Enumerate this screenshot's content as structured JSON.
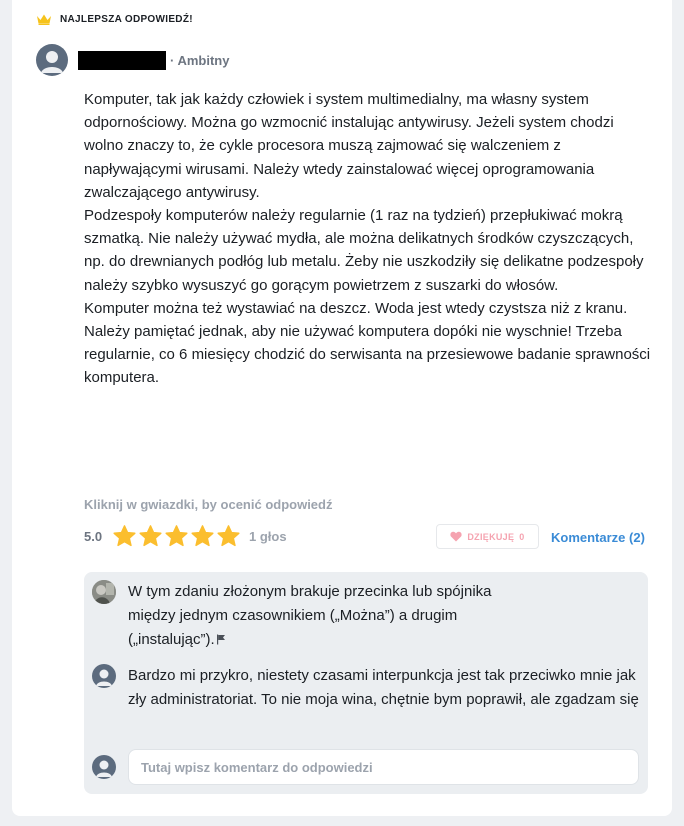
{
  "badge": {
    "label": "NAJLEPSZA ODPOWIEDŹ!",
    "icon": "crown-icon",
    "color": "#f6c31c"
  },
  "author": {
    "rank": "· Ambitny"
  },
  "answer": {
    "paragraphs": [
      "Komputer, tak jak każdy człowiek i system multimedialny, ma własny system odpornościowy. Można go wzmocnić instalując antywirusy. Jeżeli system chodzi wolno znaczy to, że cykle procesora muszą zajmować się walczeniem z napływającymi wirusami. Należy wtedy zainstalować więcej oprogramowania zwalczającego antywirusy.",
      "Podzespoły komputerów należy regularnie (1 raz na tydzień) przepłukiwać mokrą szmatką. Nie należy używać mydła, ale można delikatnych środków czyszczących, np. do drewnianych podłóg lub metalu. Żeby nie uszkodziły się delikatne podzespoły należy szybko wysuszyć go gorącym powietrzem z suszarki do włosów.",
      "Komputer można też wystawiać na deszcz. Woda jest wtedy czystsza niż z kranu. Należy pamiętać jednak, aby nie używać komputera dopóki nie wyschnie! Trzeba regularnie, co 6 miesięcy chodzić do serwisanta na przesiewowe badanie sprawności komputera."
    ]
  },
  "rating": {
    "hint": "Kliknij w gwiazdki, by ocenić odpowiedź",
    "score": "5.0",
    "stars_filled": 5,
    "stars_total": 5,
    "votes": "1 głos",
    "star_color": "#fbbe2e"
  },
  "actions": {
    "thanks_label": "DZIĘKUJĘ",
    "thanks_count": "0",
    "comments_label": "Komentarze (2)",
    "link_color": "#3a8bd6"
  },
  "comments": [
    {
      "text": "W tym zdaniu złożonym brakuje przecinka lub spójnika między jednym czasownikiem („Można”) a drugim („instalując”).",
      "has_flag": true
    },
    {
      "text": "Bardzo mi przykro, niestety czasami interpunkcja jest tak przeciwko mnie jak zły administratoriat. To nie moja wina, chętnie bym poprawił, ale zgadzam się",
      "has_flag": false
    }
  ],
  "comment_input": {
    "placeholder": "Tutaj wpisz komentarz do odpowiedzi"
  }
}
